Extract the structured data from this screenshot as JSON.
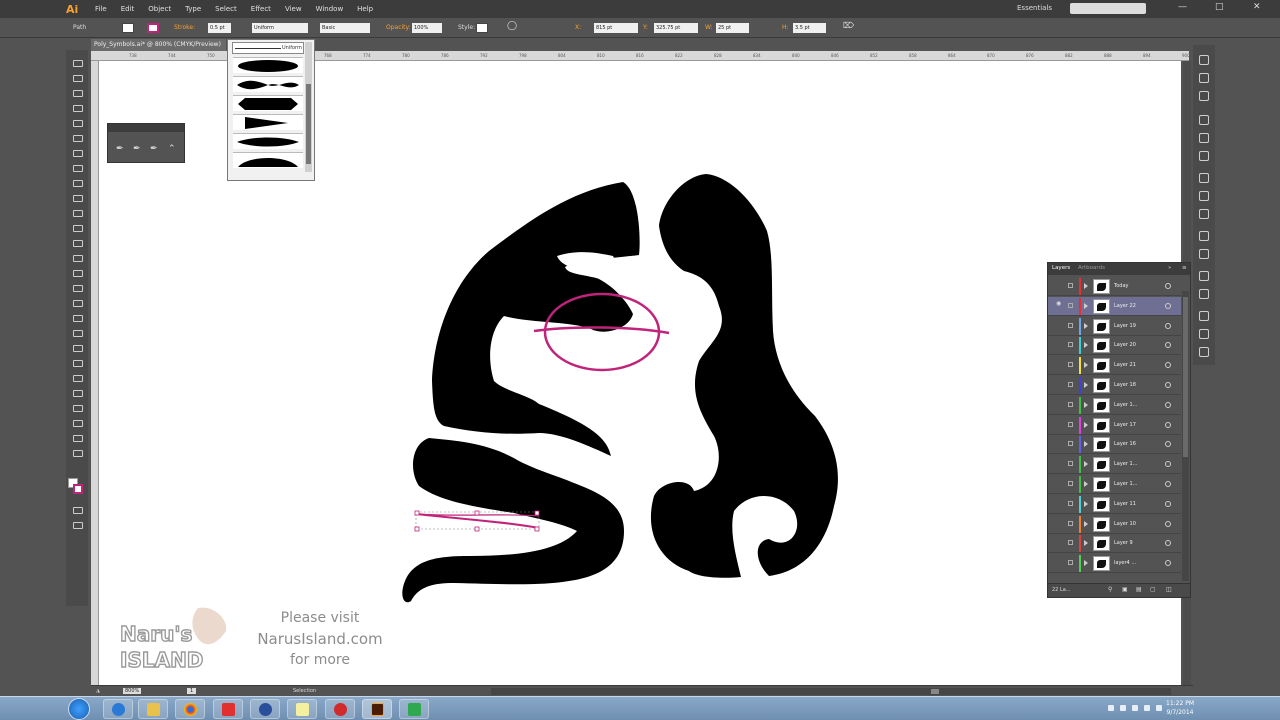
{
  "app": {
    "logo": "Ai",
    "workspace": "Essentials"
  },
  "menu": [
    "File",
    "Edit",
    "Object",
    "Type",
    "Select",
    "Effect",
    "View",
    "Window",
    "Help"
  ],
  "control": {
    "selection_type": "Path",
    "stroke_label": "Stroke:",
    "stroke_value": "0.5 pt",
    "profile_value": "Uniform",
    "brush_value": "Basic",
    "opacity_label": "Opacity:",
    "opacity_value": "100%",
    "style_label": "Style:",
    "x_label": "X:",
    "x_value": "815 pt",
    "y_label": "Y:",
    "y_value": "325.75 pt",
    "w_label": "W:",
    "w_value": "25 pt",
    "h_label": "H:",
    "h_value": "3.5 pt"
  },
  "document": {
    "tab_title": "Poly_Symbols.ai* @ 800% (CMYK/Preview)"
  },
  "ruler_ticks": [
    "738",
    "744",
    "750",
    "756",
    "762",
    "768",
    "774",
    "780",
    "786",
    "792",
    "798",
    "804",
    "810",
    "816",
    "822",
    "828",
    "834",
    "840",
    "846",
    "852",
    "858",
    "864",
    "870",
    "876",
    "882",
    "888",
    "894",
    "900"
  ],
  "profile_dropdown": {
    "selected": "Uniform"
  },
  "layers_panel": {
    "tabs": [
      "Layers",
      "Artboards"
    ],
    "footer_count": "22 La...",
    "rows": [
      {
        "name": "Today",
        "color": "#e83030",
        "selected": false
      },
      {
        "name": "Layer 22",
        "color": "#e83030",
        "selected": true
      },
      {
        "name": "Layer 19",
        "color": "#6aa6e8",
        "selected": false
      },
      {
        "name": "Layer 20",
        "color": "#3dd0d0",
        "selected": false
      },
      {
        "name": "Layer 21",
        "color": "#f0e040",
        "selected": false
      },
      {
        "name": "Layer 18",
        "color": "#4040e0",
        "selected": false
      },
      {
        "name": "Layer 1...",
        "color": "#40c040",
        "selected": false
      },
      {
        "name": "Layer 17",
        "color": "#e040e0",
        "selected": false
      },
      {
        "name": "Layer 16",
        "color": "#6060e8",
        "selected": false
      },
      {
        "name": "Layer 1...",
        "color": "#40c040",
        "selected": false
      },
      {
        "name": "Layer 1...",
        "color": "#40c040",
        "selected": false
      },
      {
        "name": "Layer 11",
        "color": "#50d0d0",
        "selected": false
      },
      {
        "name": "Layer 10",
        "color": "#f08030",
        "selected": false
      },
      {
        "name": "Layer 9",
        "color": "#e04040",
        "selected": false
      },
      {
        "name": "layer4 ...",
        "color": "#50d050",
        "selected": false
      }
    ]
  },
  "status": {
    "zoom": "800%",
    "page": "1",
    "tool": "Selection"
  },
  "watermark": {
    "logo_line1": "Naru's",
    "logo_line2": "ISLAND",
    "line1": "Please visit",
    "line2": "NarusIsland.com",
    "line3": "for more"
  },
  "clock": {
    "time": "11:22 PM",
    "date": "9/7/2014"
  },
  "colors": {
    "selection_path": "#c0247a",
    "art": "#000000"
  }
}
